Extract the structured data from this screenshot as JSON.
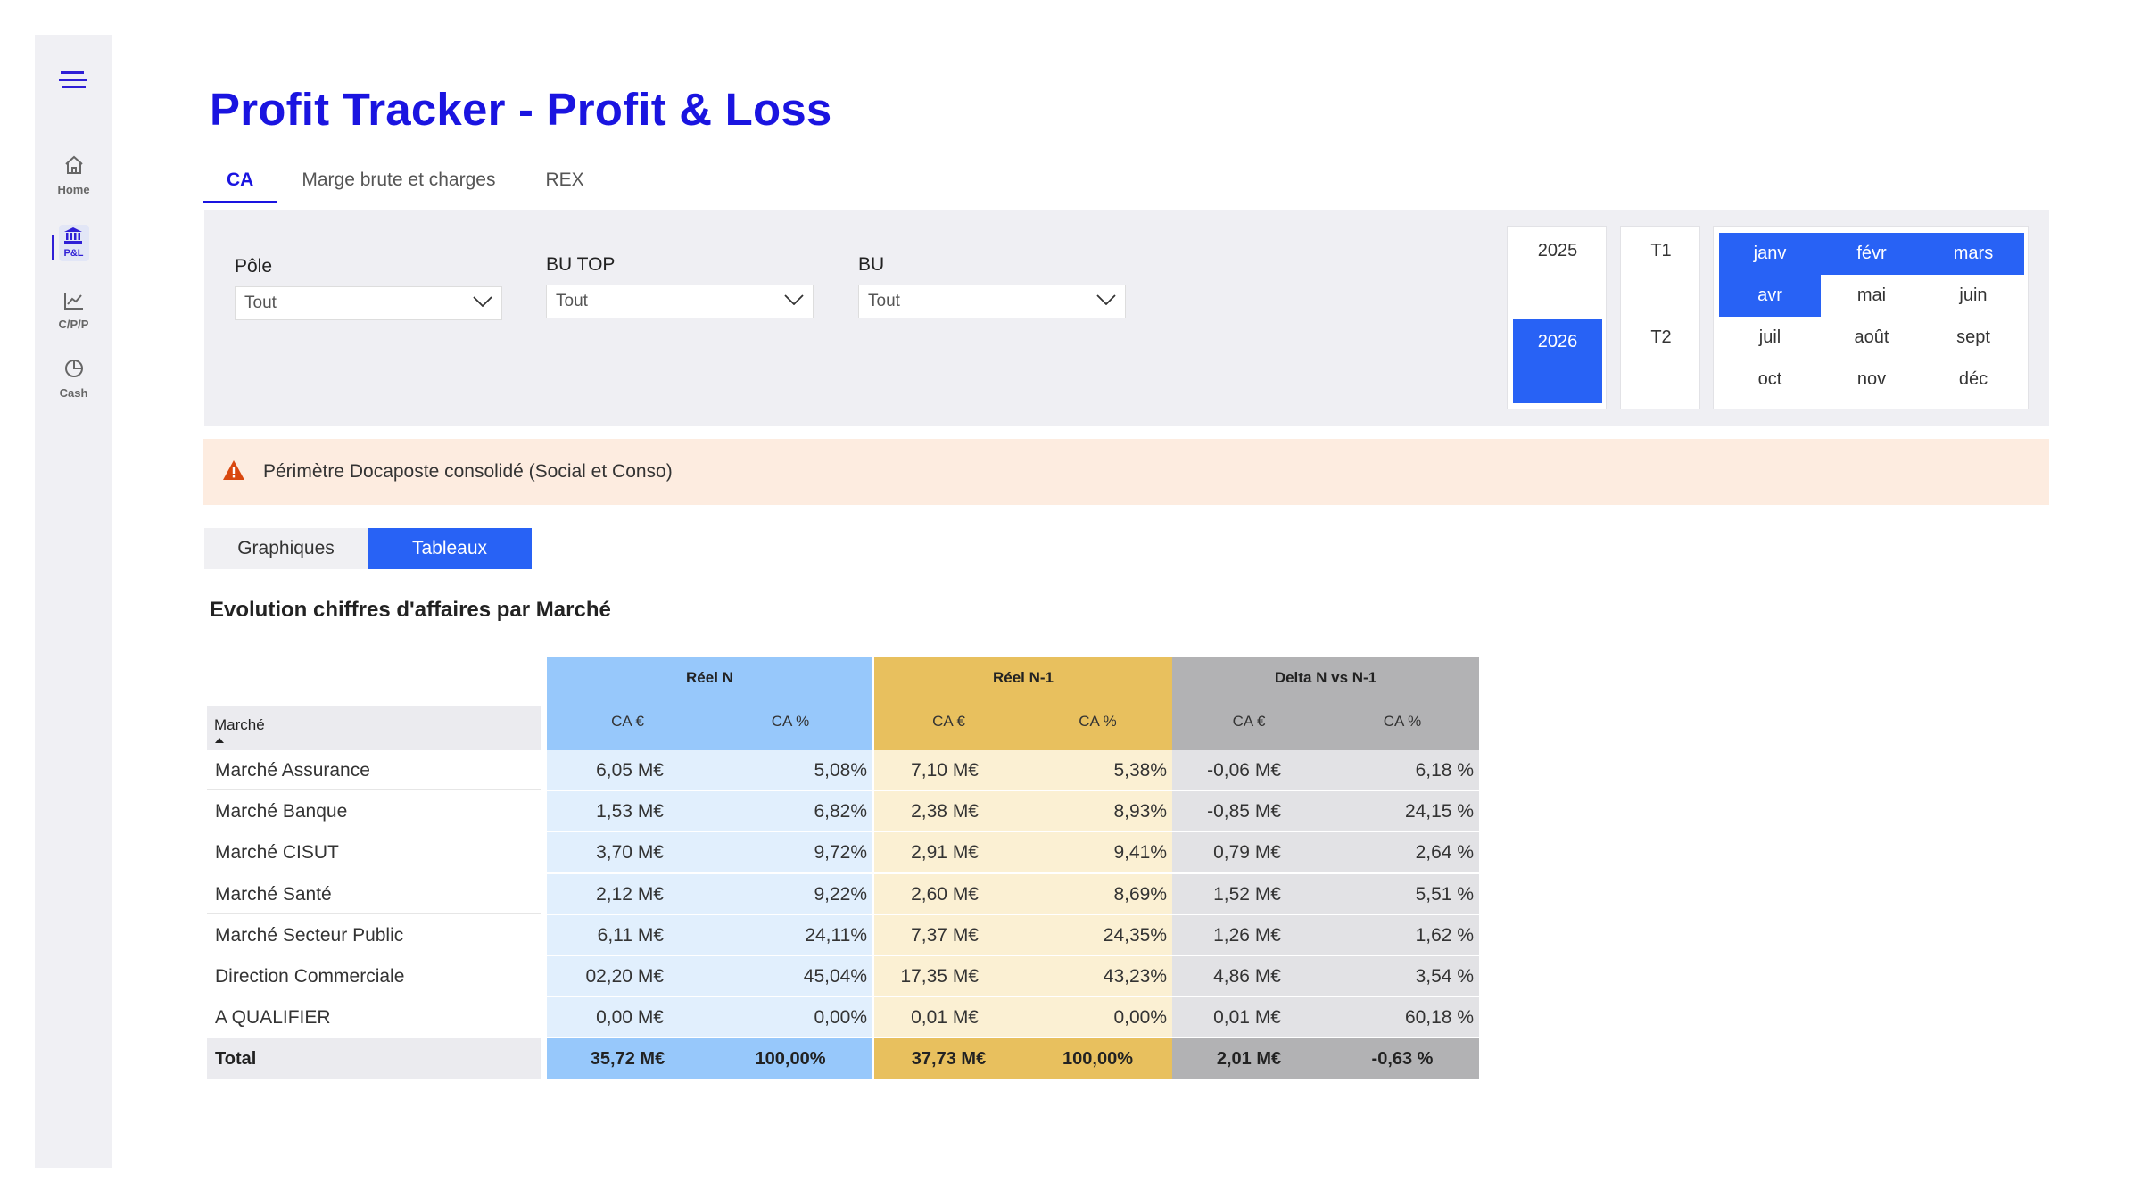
{
  "sidebar": {
    "items": [
      {
        "label": "Home",
        "icon": "home-icon"
      },
      {
        "label": "P&L",
        "icon": "bank-icon"
      },
      {
        "label": "C/P/P",
        "icon": "line-chart-icon"
      },
      {
        "label": "Cash",
        "icon": "pie-chart-icon"
      }
    ],
    "active_index": 1,
    "accent": "#2f1fd6"
  },
  "header": {
    "title": "Profit Tracker - Profit & Loss",
    "tabs": [
      {
        "label": "CA",
        "active": true
      },
      {
        "label": "Marge brute et charges",
        "active": false
      },
      {
        "label": "REX",
        "active": false
      }
    ]
  },
  "filters": {
    "pole": {
      "label": "Pôle",
      "value": "Tout"
    },
    "bu_top": {
      "label": "BU TOP",
      "value": "Tout"
    },
    "bu": {
      "label": "BU",
      "value": "Tout"
    },
    "years": [
      {
        "label": "2025",
        "selected": false
      },
      {
        "label": "2026",
        "selected": true
      }
    ],
    "quarters": [
      {
        "label": "T1",
        "selected": false
      },
      {
        "label": "T2",
        "selected": false
      }
    ],
    "months": [
      {
        "label": "janv",
        "selected": true
      },
      {
        "label": "févr",
        "selected": true
      },
      {
        "label": "mars",
        "selected": true
      },
      {
        "label": "avr",
        "selected": true
      },
      {
        "label": "mai",
        "selected": false
      },
      {
        "label": "juin",
        "selected": false
      },
      {
        "label": "juil",
        "selected": false
      },
      {
        "label": "août",
        "selected": false
      },
      {
        "label": "sept",
        "selected": false
      },
      {
        "label": "oct",
        "selected": false
      },
      {
        "label": "nov",
        "selected": false
      },
      {
        "label": "déc",
        "selected": false
      }
    ],
    "selected_color": "#2862f5"
  },
  "warning": {
    "text": "Périmètre Docaposte consolidé (Social et Conso)",
    "icon": "warning-icon",
    "color": "#d9480f"
  },
  "view_toggle": {
    "options": [
      "Graphiques",
      "Tableaux"
    ],
    "active": "Tableaux"
  },
  "table": {
    "title": "Evolution chiffres d'affaires par Marché",
    "market_header": "Marché",
    "groups": [
      {
        "title": "Réel N",
        "cols": [
          "CA €",
          "CA %"
        ],
        "header_color": "#97c8fb",
        "cell_color": "#e1effd"
      },
      {
        "title": "Réel N-1",
        "cols": [
          "CA €",
          "CA %"
        ],
        "header_color": "#e8c05e",
        "cell_color": "#fbf0d3"
      },
      {
        "title": "Delta N vs N-1",
        "cols": [
          "CA €",
          "CA %"
        ],
        "header_color": "#b2b2b4",
        "cell_color": "#e2e2e5"
      }
    ],
    "rows": [
      {
        "name": "Marché Assurance",
        "values": [
          "6,05 M€",
          "5,08%",
          "7,10 M€",
          "5,38%",
          "-0,06 M€",
          "6,18 %"
        ]
      },
      {
        "name": "Marché Banque",
        "values": [
          "1,53 M€",
          "6,82%",
          "2,38 M€",
          "8,93%",
          "-0,85 M€",
          "24,15 %"
        ]
      },
      {
        "name": "Marché CISUT",
        "values": [
          "3,70 M€",
          "9,72%",
          "2,91 M€",
          "9,41%",
          "0,79 M€",
          "2,64 %"
        ]
      },
      {
        "name": "Marché Santé",
        "values": [
          "2,12 M€",
          "9,22%",
          "2,60 M€",
          "8,69%",
          "1,52 M€",
          "5,51 %"
        ]
      },
      {
        "name": "Marché Secteur Public",
        "values": [
          "6,11 M€",
          "24,11%",
          "7,37 M€",
          "24,35%",
          "1,26 M€",
          "1,62 %"
        ]
      },
      {
        "name": "Direction Commerciale",
        "values": [
          "02,20 M€",
          "45,04%",
          "17,35 M€",
          "43,23%",
          "4,86 M€",
          "3,54 %"
        ]
      },
      {
        "name": "A QUALIFIER",
        "values": [
          "0,00 M€",
          "0,00%",
          "0,01 M€",
          "0,00%",
          "0,01 M€",
          "60,18 %"
        ]
      }
    ],
    "total": {
      "name": "Total",
      "values": [
        "35,72 M€",
        "100,00%",
        "37,73 M€",
        "100,00%",
        "2,01 M€",
        "-0,63 %"
      ]
    }
  }
}
